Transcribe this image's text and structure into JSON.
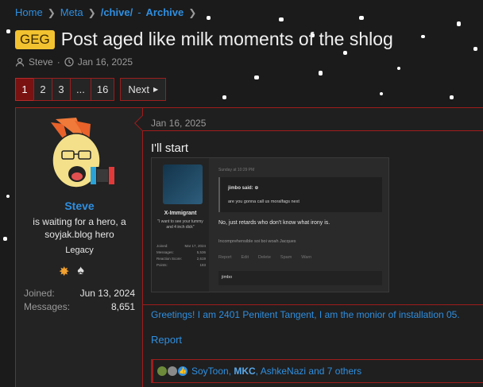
{
  "breadcrumb": {
    "items": [
      {
        "label": "Home"
      },
      {
        "label": "Meta"
      },
      {
        "label": "/chive/"
      },
      {
        "label": "-"
      },
      {
        "label": "Archive"
      }
    ]
  },
  "thread": {
    "prefix": "GEG",
    "title": "Post aged like milk moments of the shlog",
    "author": "Steve",
    "date": "Jan 16, 2025"
  },
  "pagination": {
    "pages": [
      "1",
      "2",
      "3",
      "...",
      "16"
    ],
    "current": "1",
    "next_label": "Next"
  },
  "post": {
    "user": {
      "name": "Steve",
      "title": "is waiting for a hero, a soyjak.blog hero",
      "banner": "Legacy",
      "joined_label": "Joined:",
      "joined_value": "Jun 13, 2024",
      "messages_label": "Messages:",
      "messages_value": "8,651"
    },
    "date": "Jan 16, 2025",
    "text": "I'll start",
    "embed": {
      "username": "X-Immigrant",
      "user_quote": "\"I want to see your tummy and 4 inch dick\"",
      "stats": [
        {
          "k": "Joined:",
          "v": "Mar 17, 2024"
        },
        {
          "k": "Messages:",
          "v": "5,536"
        },
        {
          "k": "Reaction Score:",
          "v": "2,619"
        },
        {
          "k": "Points:",
          "v": "183"
        }
      ],
      "timestamp": "Sunday at 10:29 PM",
      "quote_author": "jimbo said: ⊕",
      "quote_text": "are you gonna call us moralfags next",
      "body": "No, just retards who don't know what irony is.",
      "signature": "Incomprehensible soi boi woah Jacques",
      "actions": [
        "Report",
        "Edit",
        "Delete",
        "Spam",
        "Warn"
      ],
      "reply": "jimbo"
    },
    "signature": "Greetings! I am 2401 Penitent Tangent, I am the monior of installation 05.",
    "report": "Report",
    "reactions": {
      "names_a": "SoyToon, ",
      "names_b": "MKC",
      "names_c": ", AshkeNazi and 7 others"
    }
  },
  "colors": {
    "accent_red": "#a01c1c",
    "link_blue": "#2f8fe0",
    "prefix_yellow": "#f2c230",
    "background": "#1b1b1b"
  }
}
